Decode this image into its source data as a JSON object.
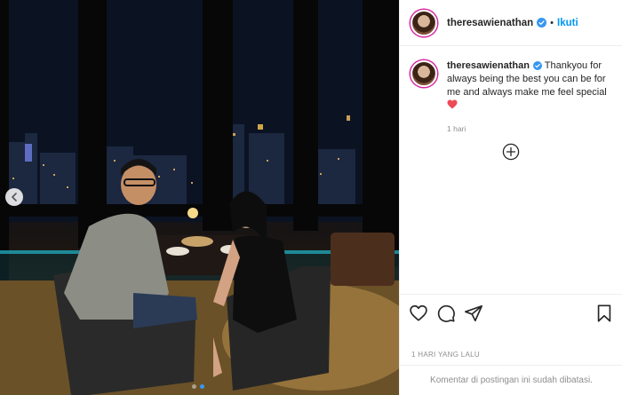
{
  "header": {
    "username": "theresawienathan",
    "separator": "•",
    "follow_label": "Ikuti"
  },
  "caption": {
    "username": "theresawienathan",
    "text": "Thankyou for always being the best you can be for me and always make me feel special",
    "emoji": "heart-emoji",
    "time": "1 hari"
  },
  "post": {
    "date_label": "1 HARI YANG LALU",
    "comments_limited": "Komentar di postingan ini sudah dibatasi.",
    "carousel": {
      "total": 2,
      "active": 2
    }
  },
  "icons": {
    "like": "heart-outline-icon",
    "comment": "comment-icon",
    "share": "paper-plane-icon",
    "save": "bookmark-icon",
    "verified": "verified-badge-icon",
    "more_comments": "plus-circle-icon",
    "prev": "chevron-left-icon"
  },
  "colors": {
    "link_blue": "#0095f6",
    "verified_blue": "#3897f0",
    "heart_red": "#ed4956",
    "muted_text": "#8e8e8e",
    "border": "#efefef"
  }
}
